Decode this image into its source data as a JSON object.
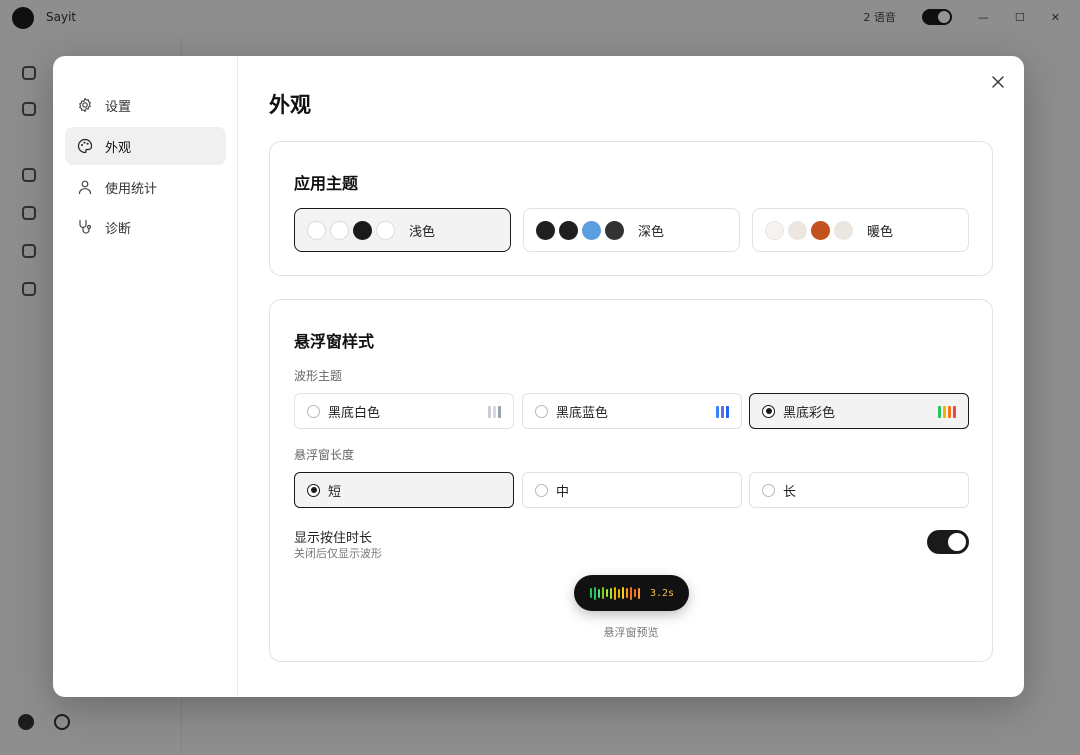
{
  "background": {
    "app_name": "Sayit",
    "status_text": "2 语音"
  },
  "nav": {
    "items": [
      {
        "id": "settings",
        "label": "设置",
        "icon": "gear-icon"
      },
      {
        "id": "appearance",
        "label": "外观",
        "icon": "palette-icon",
        "active": true
      },
      {
        "id": "usage",
        "label": "使用统计",
        "icon": "user-icon"
      },
      {
        "id": "diagnose",
        "label": "诊断",
        "icon": "stethoscope-icon"
      }
    ]
  },
  "page": {
    "title": "外观",
    "close_icon": "close-icon"
  },
  "theme": {
    "title": "应用主题",
    "options": [
      {
        "label": "浅色",
        "selected": true,
        "swatches": [
          "#ffffff",
          "#ffffff",
          "#1a1a1a",
          "#ffffff"
        ]
      },
      {
        "label": "深色",
        "selected": false,
        "swatches": [
          "#1f1f1f",
          "#1f1f1f",
          "#5b9fe0",
          "#333333"
        ]
      },
      {
        "label": "暖色",
        "selected": false,
        "swatches": [
          "#f6f4f0",
          "#ebe7e0",
          "#c4521e",
          "#ebe7e0"
        ]
      }
    ]
  },
  "floating": {
    "title": "悬浮窗样式",
    "wave_label": "波形主题",
    "wave_options": [
      {
        "label": "黑底白色",
        "selected": false,
        "bar_colors": [
          "#c9ccd2",
          "#d6d9de",
          "#9aa3ae"
        ]
      },
      {
        "label": "黑底蓝色",
        "selected": false,
        "bar_colors": [
          "#3b82f6",
          "#6366f1",
          "#2563eb"
        ]
      },
      {
        "label": "黑底彩色",
        "selected": true,
        "bar_colors": [
          "#22c55e",
          "#eab308",
          "#f97316",
          "#ef4444"
        ]
      }
    ],
    "length_label": "悬浮窗长度",
    "length_options": [
      {
        "label": "短",
        "selected": true
      },
      {
        "label": "中",
        "selected": false
      },
      {
        "label": "长",
        "selected": false
      }
    ],
    "show_duration": {
      "title": "显示按住时长",
      "subtitle": "关闭后仅显示波形",
      "enabled": true
    },
    "preview": {
      "timer": "3.2s",
      "label": "悬浮窗预览"
    }
  }
}
